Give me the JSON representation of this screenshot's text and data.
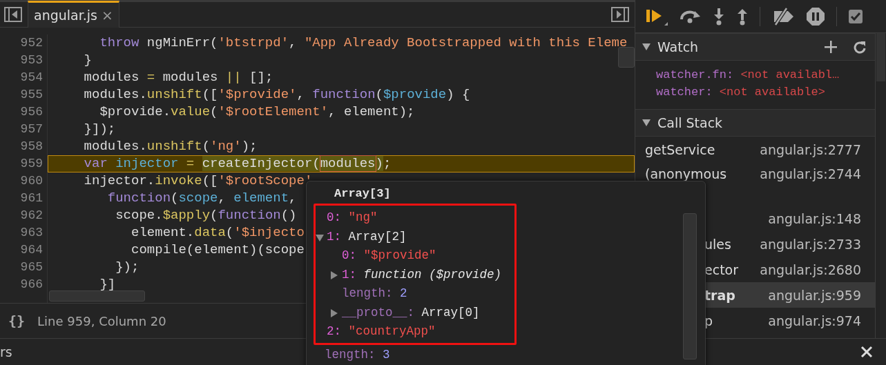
{
  "editor_tab": {
    "label": "angular.js",
    "close": "×",
    "selected": true
  },
  "code_lines": [
    {
      "number": "952",
      "highlighted": false,
      "tokens": [
        {
          "text": "      throw",
          "kind": "keyword"
        },
        {
          "text": " ngMinErr(",
          "kind": "plain"
        },
        {
          "text": "'btstrpd'",
          "kind": "string"
        },
        {
          "text": ", ",
          "kind": "plain"
        },
        {
          "text": "\"App Already Bootstrapped with this Eleme",
          "kind": "string"
        }
      ]
    },
    {
      "number": "953",
      "highlighted": false,
      "tokens": [
        {
          "text": "    }",
          "kind": "plain"
        }
      ]
    },
    {
      "number": "954",
      "highlighted": false,
      "tokens": [
        {
          "text": "    modules ",
          "kind": "plain"
        },
        {
          "text": "=",
          "kind": "operator"
        },
        {
          "text": " modules ",
          "kind": "plain"
        },
        {
          "text": "||",
          "kind": "operator"
        },
        {
          "text": " [];",
          "kind": "plain"
        }
      ]
    },
    {
      "number": "955",
      "highlighted": false,
      "tokens": [
        {
          "text": "    modules.",
          "kind": "plain"
        },
        {
          "text": "unshift",
          "kind": "method"
        },
        {
          "text": "([",
          "kind": "plain"
        },
        {
          "text": "'$provide'",
          "kind": "string"
        },
        {
          "text": ", ",
          "kind": "plain"
        },
        {
          "text": "function",
          "kind": "keyword"
        },
        {
          "text": "(",
          "kind": "plain"
        },
        {
          "text": "$provide",
          "kind": "variable"
        },
        {
          "text": ") {",
          "kind": "plain"
        }
      ]
    },
    {
      "number": "956",
      "highlighted": false,
      "tokens": [
        {
          "text": "      $provide.",
          "kind": "plain"
        },
        {
          "text": "value",
          "kind": "method"
        },
        {
          "text": "(",
          "kind": "plain"
        },
        {
          "text": "'$rootElement'",
          "kind": "string"
        },
        {
          "text": ", element);",
          "kind": "plain"
        }
      ]
    },
    {
      "number": "957",
      "highlighted": false,
      "tokens": [
        {
          "text": "    }]);",
          "kind": "plain"
        }
      ]
    },
    {
      "number": "958",
      "highlighted": false,
      "tokens": [
        {
          "text": "    modules.",
          "kind": "plain"
        },
        {
          "text": "unshift",
          "kind": "method"
        },
        {
          "text": "(",
          "kind": "plain"
        },
        {
          "text": "'ng'",
          "kind": "string"
        },
        {
          "text": ");",
          "kind": "plain"
        }
      ]
    },
    {
      "number": "959",
      "highlighted": true,
      "tokens": [
        {
          "text": "    var ",
          "kind": "keyword"
        },
        {
          "text": "injector ",
          "kind": "variable"
        },
        {
          "text": "= ",
          "kind": "operator"
        },
        {
          "text": "createInjector(",
          "kind": "evaluated"
        },
        {
          "text": "modules",
          "kind": "hovered"
        },
        {
          "text": ")",
          "kind": "evaluated"
        },
        {
          "text": ";",
          "kind": "plain"
        }
      ]
    },
    {
      "number": "960",
      "highlighted": false,
      "tokens": [
        {
          "text": "    injector.",
          "kind": "plain"
        },
        {
          "text": "invoke",
          "kind": "method"
        },
        {
          "text": "([",
          "kind": "plain"
        },
        {
          "text": "'$rootScope'",
          "kind": "string"
        }
      ]
    },
    {
      "number": "961",
      "highlighted": false,
      "tokens": [
        {
          "text": "       function",
          "kind": "keyword"
        },
        {
          "text": "(",
          "kind": "plain"
        },
        {
          "text": "scope",
          "kind": "variable"
        },
        {
          "text": ", ",
          "kind": "plain"
        },
        {
          "text": "element",
          "kind": "variable"
        },
        {
          "text": ",",
          "kind": "plain"
        }
      ]
    },
    {
      "number": "962",
      "highlighted": false,
      "tokens": [
        {
          "text": "        scope.",
          "kind": "plain"
        },
        {
          "text": "$apply",
          "kind": "method"
        },
        {
          "text": "(",
          "kind": "plain"
        },
        {
          "text": "function",
          "kind": "keyword"
        },
        {
          "text": "()",
          "kind": "plain"
        }
      ]
    },
    {
      "number": "963",
      "highlighted": false,
      "tokens": [
        {
          "text": "          element.",
          "kind": "plain"
        },
        {
          "text": "data",
          "kind": "method"
        },
        {
          "text": "(",
          "kind": "plain"
        },
        {
          "text": "'$injecto",
          "kind": "string"
        }
      ]
    },
    {
      "number": "964",
      "highlighted": false,
      "tokens": [
        {
          "text": "          compile(element)(scope",
          "kind": "plain"
        }
      ]
    },
    {
      "number": "965",
      "highlighted": false,
      "tokens": [
        {
          "text": "        });",
          "kind": "plain"
        }
      ]
    },
    {
      "number": "966",
      "highlighted": false,
      "tokens": [
        {
          "text": "      }]",
          "kind": "plain"
        }
      ]
    }
  ],
  "status_bar": {
    "format_icon": "{}",
    "position": "Line 959, Column 20"
  },
  "drawer": {
    "label": "rs"
  },
  "debugger": {
    "watch": {
      "title": "Watch",
      "expanded": true,
      "items": [
        {
          "name": "watcher.fn:",
          "value": "<not availabl…"
        },
        {
          "name": "watcher:",
          "value": "<not available>"
        }
      ]
    },
    "call_stack": {
      "title": "Call Stack",
      "expanded": true,
      "frames": [
        {
          "name": "getService",
          "location": "angular.js:2777",
          "selected": false,
          "covered": false
        },
        {
          "name": "(anonymous",
          "location": "angular.js:2744",
          "selected": false,
          "covered": false
        },
        {
          "location": "angular.js:148",
          "selected": false,
          "covered": true
        },
        {
          "name": "ules",
          "location": "angular.js:2733",
          "selected": false,
          "covered": true
        },
        {
          "name": "ector",
          "location": "angular.js:2680",
          "selected": false,
          "covered": true
        },
        {
          "name": "trap",
          "location": "angular.js:959",
          "selected": true,
          "covered": true
        },
        {
          "name": "p",
          "location": "angular.js:974",
          "selected": false,
          "covered": true
        }
      ]
    }
  },
  "popover": {
    "title": "Array[3]",
    "annotated_properties": [
      {
        "key": "0:",
        "value": "\"ng\"",
        "kind": "string",
        "internal": false
      },
      {
        "key": "1:",
        "value": "Array[2]",
        "kind": "object",
        "internal": false,
        "expanded": true,
        "children": [
          {
            "key": "0:",
            "value": "\"$provide\"",
            "kind": "string",
            "internal": false
          },
          {
            "key": "1:",
            "value": "*function* ($provide)",
            "kind": "function",
            "internal": false,
            "expanded": false
          },
          {
            "key": "length:",
            "value": "2",
            "kind": "number",
            "internal": true
          },
          {
            "key": "__proto__:",
            "value": "Array[0]",
            "kind": "object",
            "internal": true,
            "expanded": false
          }
        ]
      },
      {
        "key": "2:",
        "value": "\"countryApp\"",
        "kind": "string",
        "internal": false
      }
    ],
    "properties": [
      {
        "key": "length:",
        "value": "3",
        "kind": "number",
        "internal": true
      }
    ]
  }
}
